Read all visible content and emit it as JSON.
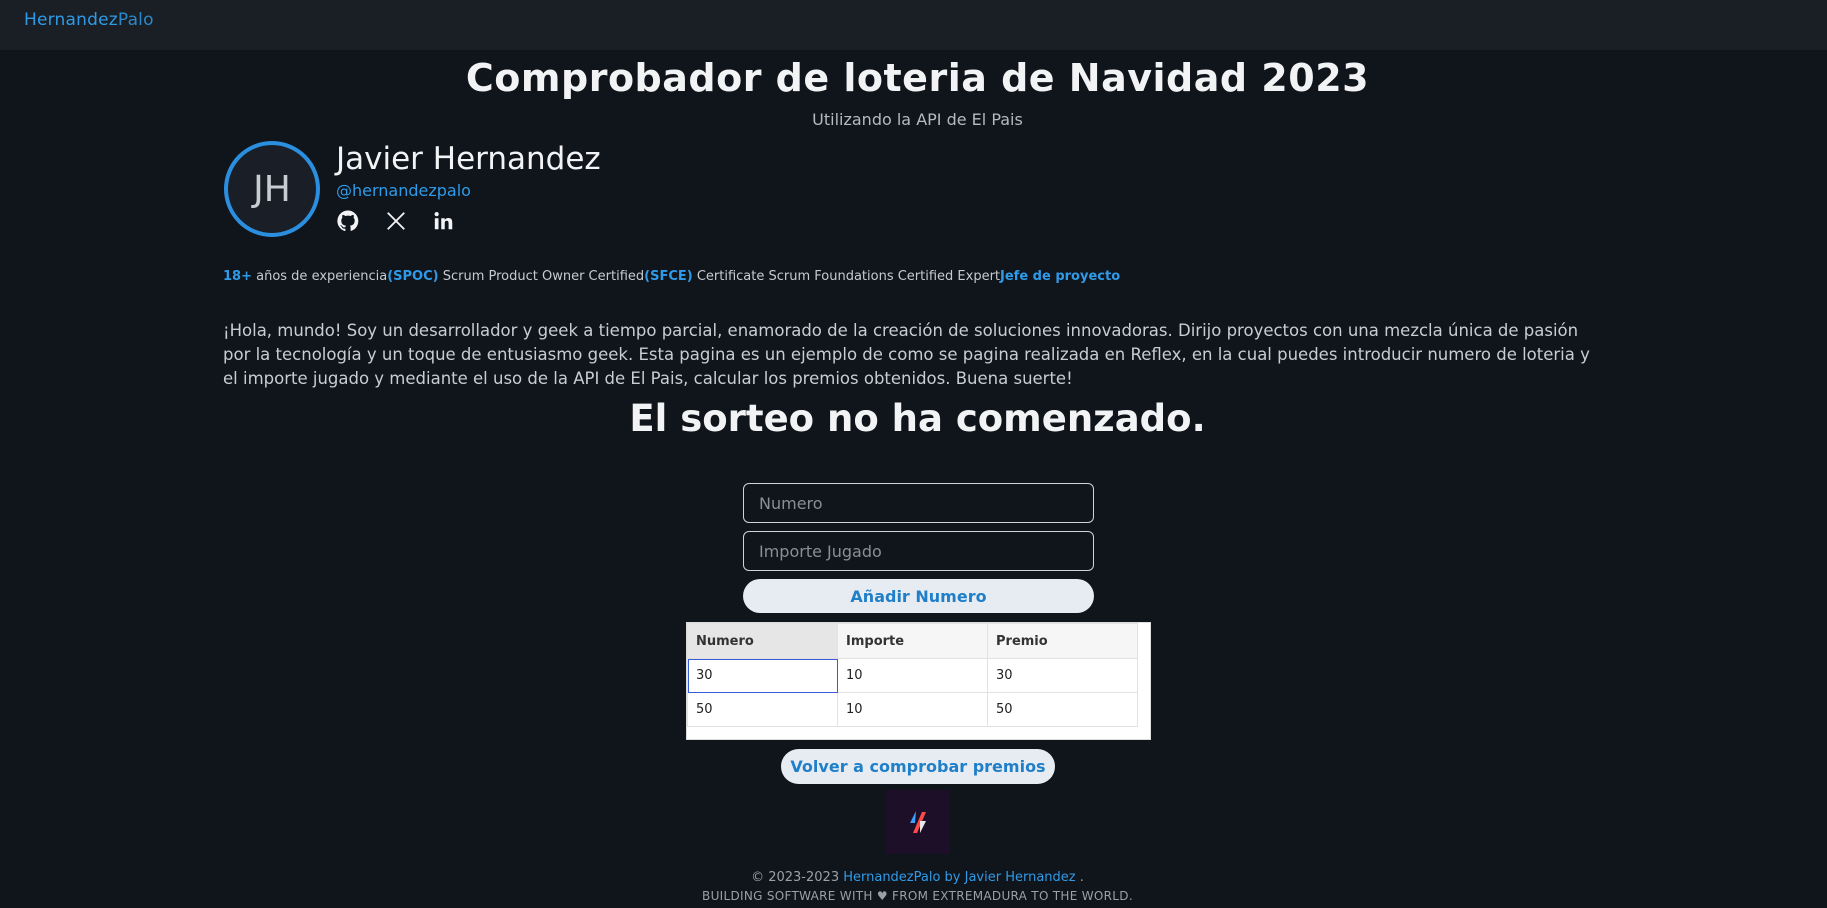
{
  "navbar": {
    "brand_first": "Hernandez",
    "brand_second": "Palo"
  },
  "header": {
    "title": "Comprobador de loteria de Navidad 2023",
    "subtitle": "Utilizando la API de El Pais"
  },
  "profile": {
    "initials": "JH",
    "name": "Javier Hernandez",
    "handle": "@hernandezpalo",
    "social": [
      "github-icon",
      "x-icon",
      "linkedin-icon"
    ]
  },
  "badges": {
    "years": "18+",
    "years_text": " años de experiencia",
    "spoc": "(SPOC)",
    "spoc_text": " Scrum Product Owner Certified",
    "sfce": "(SFCE)",
    "sfce_text": " Certificate Scrum Foundations Certified Expert",
    "role": "Jefe de proyecto"
  },
  "bio": "¡Hola, mundo! Soy un desarrollador y geek a tiempo parcial, enamorado de la creación de soluciones innovadoras. Dirijo proyectos con una mezcla única de pasión por la tecnología y un toque de entusiasmo geek. Esta pagina es un ejemplo de como se pagina realizada en Reflex, en la cual puedes introducir numero de loteria y el importe jugado y mediante el uso de la API de El Pais, calcular los premios obtenidos. Buena suerte!",
  "status": "El sorteo no ha comenzado.",
  "form": {
    "numero_placeholder": "Numero",
    "importe_placeholder": "Importe Jugado",
    "add_label": "Añadir Numero"
  },
  "table": {
    "headers": [
      "Numero",
      "Importe",
      "Premio"
    ],
    "rows": [
      [
        "30",
        "10",
        "30"
      ],
      [
        "50",
        "10",
        "50"
      ]
    ]
  },
  "check_label": "Volver a comprobar premios",
  "footer": {
    "copy": "© 2023-2023 ",
    "link": "HernandezPalo by Javier Hernandez",
    "dot": " .",
    "tagline_a": "BUILDING SOFTWARE WITH ",
    "tagline_b": " FROM EXTREMADURA TO THE WORLD."
  },
  "colors": {
    "accent": "#2f9be8",
    "background": "#10141b",
    "navbar": "#1a1e25"
  }
}
